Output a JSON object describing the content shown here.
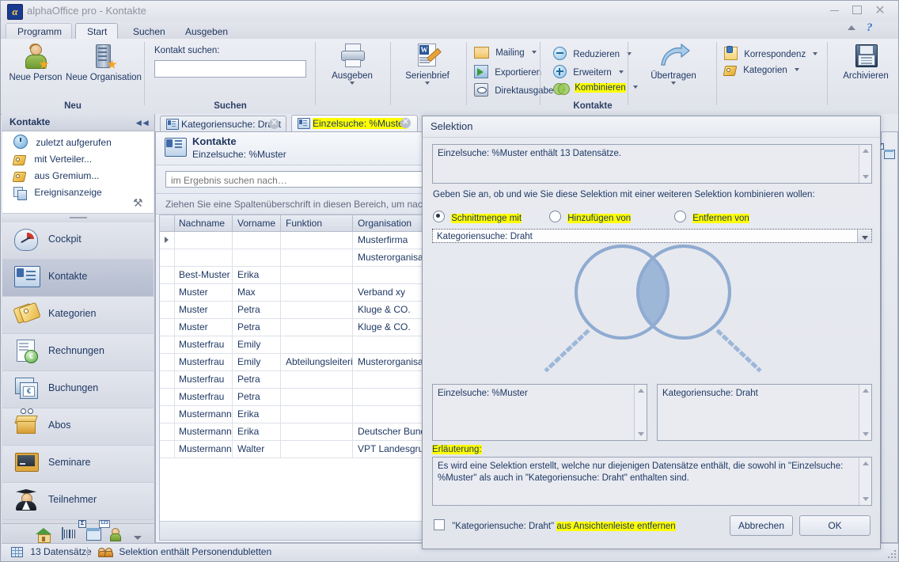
{
  "window": {
    "title": "alphaOffice pro - Kontakte",
    "logo_glyph": "α",
    "minimize": "–",
    "maximize": "□",
    "close": "✕"
  },
  "ribbon": {
    "tabs": [
      {
        "label": "Programm",
        "selected": false
      },
      {
        "label": "Start",
        "selected": true
      },
      {
        "label": "Suchen",
        "selected": false
      },
      {
        "label": "Ausgeben",
        "selected": false
      }
    ],
    "help_glyph": "?",
    "groups": [
      {
        "name": "Neu",
        "label": "Neu",
        "buttons": [
          {
            "label": "Neue Person",
            "icon": "new-person-icon"
          },
          {
            "label": "Neue Organisation",
            "icon": "new-organisation-icon"
          }
        ]
      },
      {
        "name": "Suchen",
        "label": "Suchen",
        "field_label": "Kontakt suchen:",
        "field_value": "",
        "field_placeholder": ""
      },
      {
        "name": "Kontakte",
        "label": "Kontakte",
        "big_buttons": [
          {
            "label": "Ausgeben",
            "icon": "printer-icon",
            "has_menu": true
          },
          {
            "label": "Serienbrief",
            "icon": "mailmerge-icon",
            "has_menu": true
          },
          {
            "label": "Übertragen",
            "icon": "transfer-arrow-icon",
            "has_menu": true
          },
          {
            "label": "Archivieren",
            "icon": "floppy-save-icon",
            "has_menu": false
          }
        ],
        "small_buttons": [
          {
            "label": "Mailing",
            "icon": "envelope-icon",
            "has_menu": true,
            "highlighted": false
          },
          {
            "label": "Exportieren",
            "icon": "export-icon",
            "has_menu": false,
            "highlighted": false
          },
          {
            "label": "Direktausgabe",
            "icon": "direct-output-icon",
            "has_menu": true,
            "highlighted": false
          },
          {
            "label": "Reduzieren",
            "icon": "circle-minus-icon",
            "has_menu": true,
            "highlighted": false
          },
          {
            "label": "Erweitern",
            "icon": "circle-plus-icon",
            "has_menu": true,
            "highlighted": false
          },
          {
            "label": "Kombinieren",
            "icon": "combine-venn-icon",
            "has_menu": true,
            "highlighted": true
          },
          {
            "label": "Korrespondenz",
            "icon": "note-icon",
            "has_menu": true,
            "highlighted": false
          },
          {
            "label": "Kategorien",
            "icon": "tag-icon",
            "has_menu": true,
            "highlighted": false
          }
        ]
      }
    ]
  },
  "sidebar": {
    "header": "Kontakte",
    "collapse_glyph": "◄◄",
    "links": [
      {
        "label": "zuletzt aufgerufen",
        "icon": "recent-icon"
      },
      {
        "label": "mit Verteiler...",
        "icon": "tag-icon"
      },
      {
        "label": "aus Gremium...",
        "icon": "tag-icon"
      },
      {
        "label": "Ereignisanzeige",
        "icon": "event-view-icon"
      }
    ],
    "tools_glyph": "⚒",
    "items": [
      {
        "label": "Cockpit",
        "icon": "cockpit-icon",
        "active": false
      },
      {
        "label": "Kontakte",
        "icon": "contacts-card-icon",
        "active": true
      },
      {
        "label": "Kategorien",
        "icon": "categories-tag-icon",
        "active": false
      },
      {
        "label": "Rechnungen",
        "icon": "invoice-icon",
        "active": false
      },
      {
        "label": "Buchungen",
        "icon": "bookings-icon",
        "active": false
      },
      {
        "label": "Abos",
        "icon": "subscriptions-box-icon",
        "active": false
      },
      {
        "label": "Seminare",
        "icon": "seminars-board-icon",
        "active": false
      },
      {
        "label": "Teilnehmer",
        "icon": "participants-graduate-icon",
        "active": false
      }
    ],
    "bottom_icons": [
      "home-icon",
      "barcode-icon",
      "report-icon",
      "person-number-icon",
      "more-chevron-icon"
    ]
  },
  "workspace": {
    "doc_tabs": [
      {
        "label": "Kategoriensuche: Draht",
        "selected": false,
        "highlighted": false,
        "closable": true
      },
      {
        "label": "Einzelsuche: %Muster",
        "selected": true,
        "highlighted": true,
        "closable": true
      }
    ],
    "header_title": "Kontakte",
    "header_subtitle": "Einzelsuche: %Muster",
    "search_placeholder": "im Ergebnis suchen nach…",
    "search_value": "",
    "group_hint": "Ziehen Sie eine Spaltenüberschrift in diesen Bereich, um nach dieser",
    "columns": [
      "Nachname",
      "Vorname",
      "Funktion",
      "Organisation"
    ],
    "rows": [
      {
        "nachname": "",
        "vorname": "",
        "funktion": "",
        "organisation": "Musterfirma",
        "current": true
      },
      {
        "nachname": "",
        "vorname": "",
        "funktion": "",
        "organisation": "Musterorganisation",
        "current": false
      },
      {
        "nachname": "Best-Muster",
        "vorname": "Erika",
        "funktion": "",
        "organisation": "",
        "current": false
      },
      {
        "nachname": "Muster",
        "vorname": "Max",
        "funktion": "",
        "organisation": "Verband xy",
        "current": false
      },
      {
        "nachname": "Muster",
        "vorname": "Petra",
        "funktion": "",
        "organisation": "Kluge & CO.",
        "current": false
      },
      {
        "nachname": "Muster",
        "vorname": "Petra",
        "funktion": "",
        "organisation": "Kluge & CO.",
        "current": false
      },
      {
        "nachname": "Musterfrau",
        "vorname": "Emily",
        "funktion": "",
        "organisation": "",
        "current": false
      },
      {
        "nachname": "Musterfrau",
        "vorname": "Emily",
        "funktion": "Abteilungsleiterin",
        "organisation": "Musterorganisation",
        "current": false
      },
      {
        "nachname": "Musterfrau",
        "vorname": "Petra",
        "funktion": "",
        "organisation": "",
        "current": false
      },
      {
        "nachname": "Musterfrau",
        "vorname": "Petra",
        "funktion": "",
        "organisation": "",
        "current": false
      },
      {
        "nachname": "Mustermann",
        "vorname": "Erika",
        "funktion": "",
        "organisation": "",
        "current": false
      },
      {
        "nachname": "Mustermann",
        "vorname": "Erika",
        "funktion": "",
        "organisation": "Deutscher Bundesta",
        "current": false
      },
      {
        "nachname": "Mustermann",
        "vorname": "Walter",
        "funktion": "",
        "organisation": "VPT Landesgruppe H",
        "current": false
      }
    ]
  },
  "dialog": {
    "title": "Selektion",
    "info_text": "Einzelsuche: %Muster enthält 13 Datensätze.",
    "question": "Geben Sie an, ob und wie Sie diese Selektion mit einer weiteren Selektion kombinieren wollen:",
    "options": [
      {
        "label": "Schnittmenge mit",
        "selected": true,
        "highlighted": true
      },
      {
        "label": "Hinzufügen von",
        "selected": false,
        "highlighted": true
      },
      {
        "label": "Entfernen von",
        "selected": false,
        "highlighted": true
      }
    ],
    "combo_value": "Kategoriensuche: Draht",
    "left_set": "Einzelsuche: %Muster",
    "right_set": "Kategoriensuche: Draht",
    "explanation_label": "Erläuterung:",
    "explanation_text": "Es wird eine Selektion erstellt, welche nur diejenigen Datensätze enthält, die sowohl in \"Einzelsuche: %Muster\" als auch in \"Kategoriensuche: Draht\" enthalten sind.",
    "checkbox_label_plain": "\"Kategoriensuche: Draht\" ",
    "checkbox_label_highlighted": "aus Ansichtenleiste entfernen",
    "checkbox_checked": false,
    "cancel_label": "Abbrechen",
    "ok_label": "OK",
    "venn_fill": "#9db7d9",
    "venn_stroke": "#8fabd1"
  },
  "statusbar": {
    "records": "13 Datensätze",
    "message": "Selektion enthält Personendubletten"
  },
  "colors": {
    "highlight": "#ffff00",
    "accent_blue": "#1f3864",
    "chrome": "#dde1ea"
  }
}
